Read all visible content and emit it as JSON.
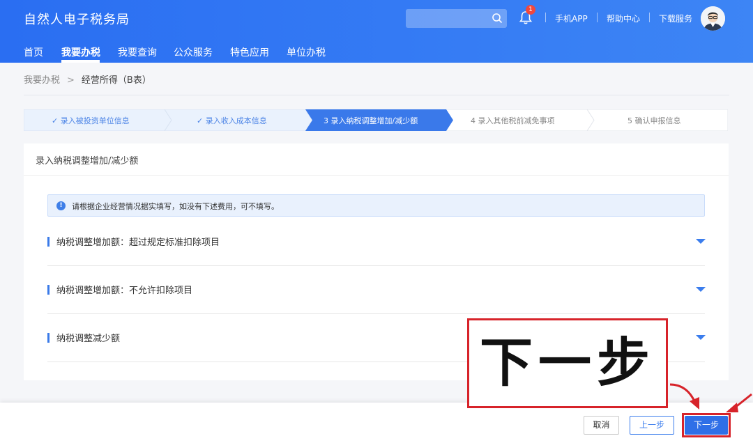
{
  "header": {
    "title": "自然人电子税务局",
    "search_placeholder": "",
    "notification_count": "1",
    "links": [
      "手机APP",
      "帮助中心",
      "下载服务"
    ]
  },
  "nav": {
    "items": [
      "首页",
      "我要办税",
      "我要查询",
      "公众服务",
      "特色应用",
      "单位办税"
    ],
    "active": "我要办税"
  },
  "breadcrumb": {
    "root": "我要办税",
    "separator": ">",
    "current": "经营所得（B表）"
  },
  "stepper": {
    "steps": [
      {
        "label": "✓ 录入被投资单位信息",
        "state": "done"
      },
      {
        "label": "✓ 录入收入成本信息",
        "state": "done"
      },
      {
        "label": "3   录入纳税调整增加/减少额",
        "state": "active"
      },
      {
        "label": "4   录入其他税前减免事项",
        "state": "todo"
      },
      {
        "label": "5   确认申报信息",
        "state": "todo"
      }
    ]
  },
  "card": {
    "title": "录入纳税调整增加/减少额",
    "notice": "请根据企业经营情况据实填写，如没有下述费用，可不填写。",
    "sections": [
      "纳税调整增加额：超过规定标准扣除项目",
      "纳税调整增加额：不允许扣除项目",
      "纳税调整减少额"
    ]
  },
  "buttons": {
    "cancel": "取消",
    "prev": "上一步",
    "next": "下一步"
  },
  "annotation": {
    "callout_text": "下一步"
  },
  "colors": {
    "brand_blue": "#2f6fe7",
    "annotation_red": "#d7232a"
  }
}
